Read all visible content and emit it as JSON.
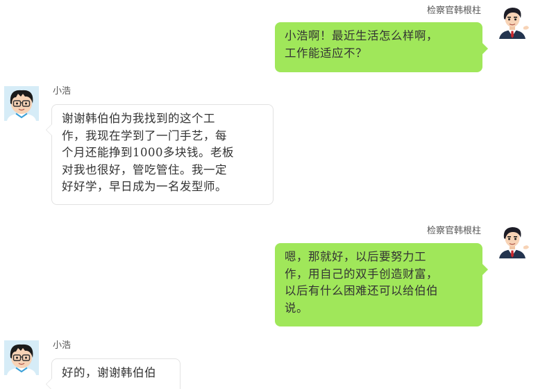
{
  "messages": [
    {
      "side": "right",
      "sender": "检察官韩根柱",
      "avatar_icon": "prosecutor-avatar-icon",
      "lines": [
        "小浩啊！最近生活怎么样啊，",
        "工作能适应不？"
      ]
    },
    {
      "side": "left",
      "sender": "小浩",
      "avatar_icon": "boy-with-glasses-avatar-icon",
      "lines": [
        "谢谢韩伯伯为我找到的这个工",
        "作，我现在学到了一门手艺，每",
        "个月还能挣到1000多块钱。老板",
        "对我也很好，管吃管住。我一定",
        "好好学，早日成为一名发型师。"
      ]
    },
    {
      "side": "right",
      "sender": "检察官韩根柱",
      "avatar_icon": "prosecutor-avatar-icon",
      "lines": [
        "嗯，那就好，以后要努力工",
        "作，用自己的双手创造财富，",
        "以后有什么困难还可以给伯伯",
        "说。"
      ]
    },
    {
      "side": "left",
      "sender": "小浩",
      "avatar_icon": "boy-with-glasses-avatar-icon",
      "lines": [
        "好的，谢谢韩伯伯"
      ]
    }
  ],
  "colors": {
    "right_bubble": "#a0e75a",
    "left_bubble_border": "#e2e2e2",
    "text": "#333333",
    "name": "#555555"
  }
}
